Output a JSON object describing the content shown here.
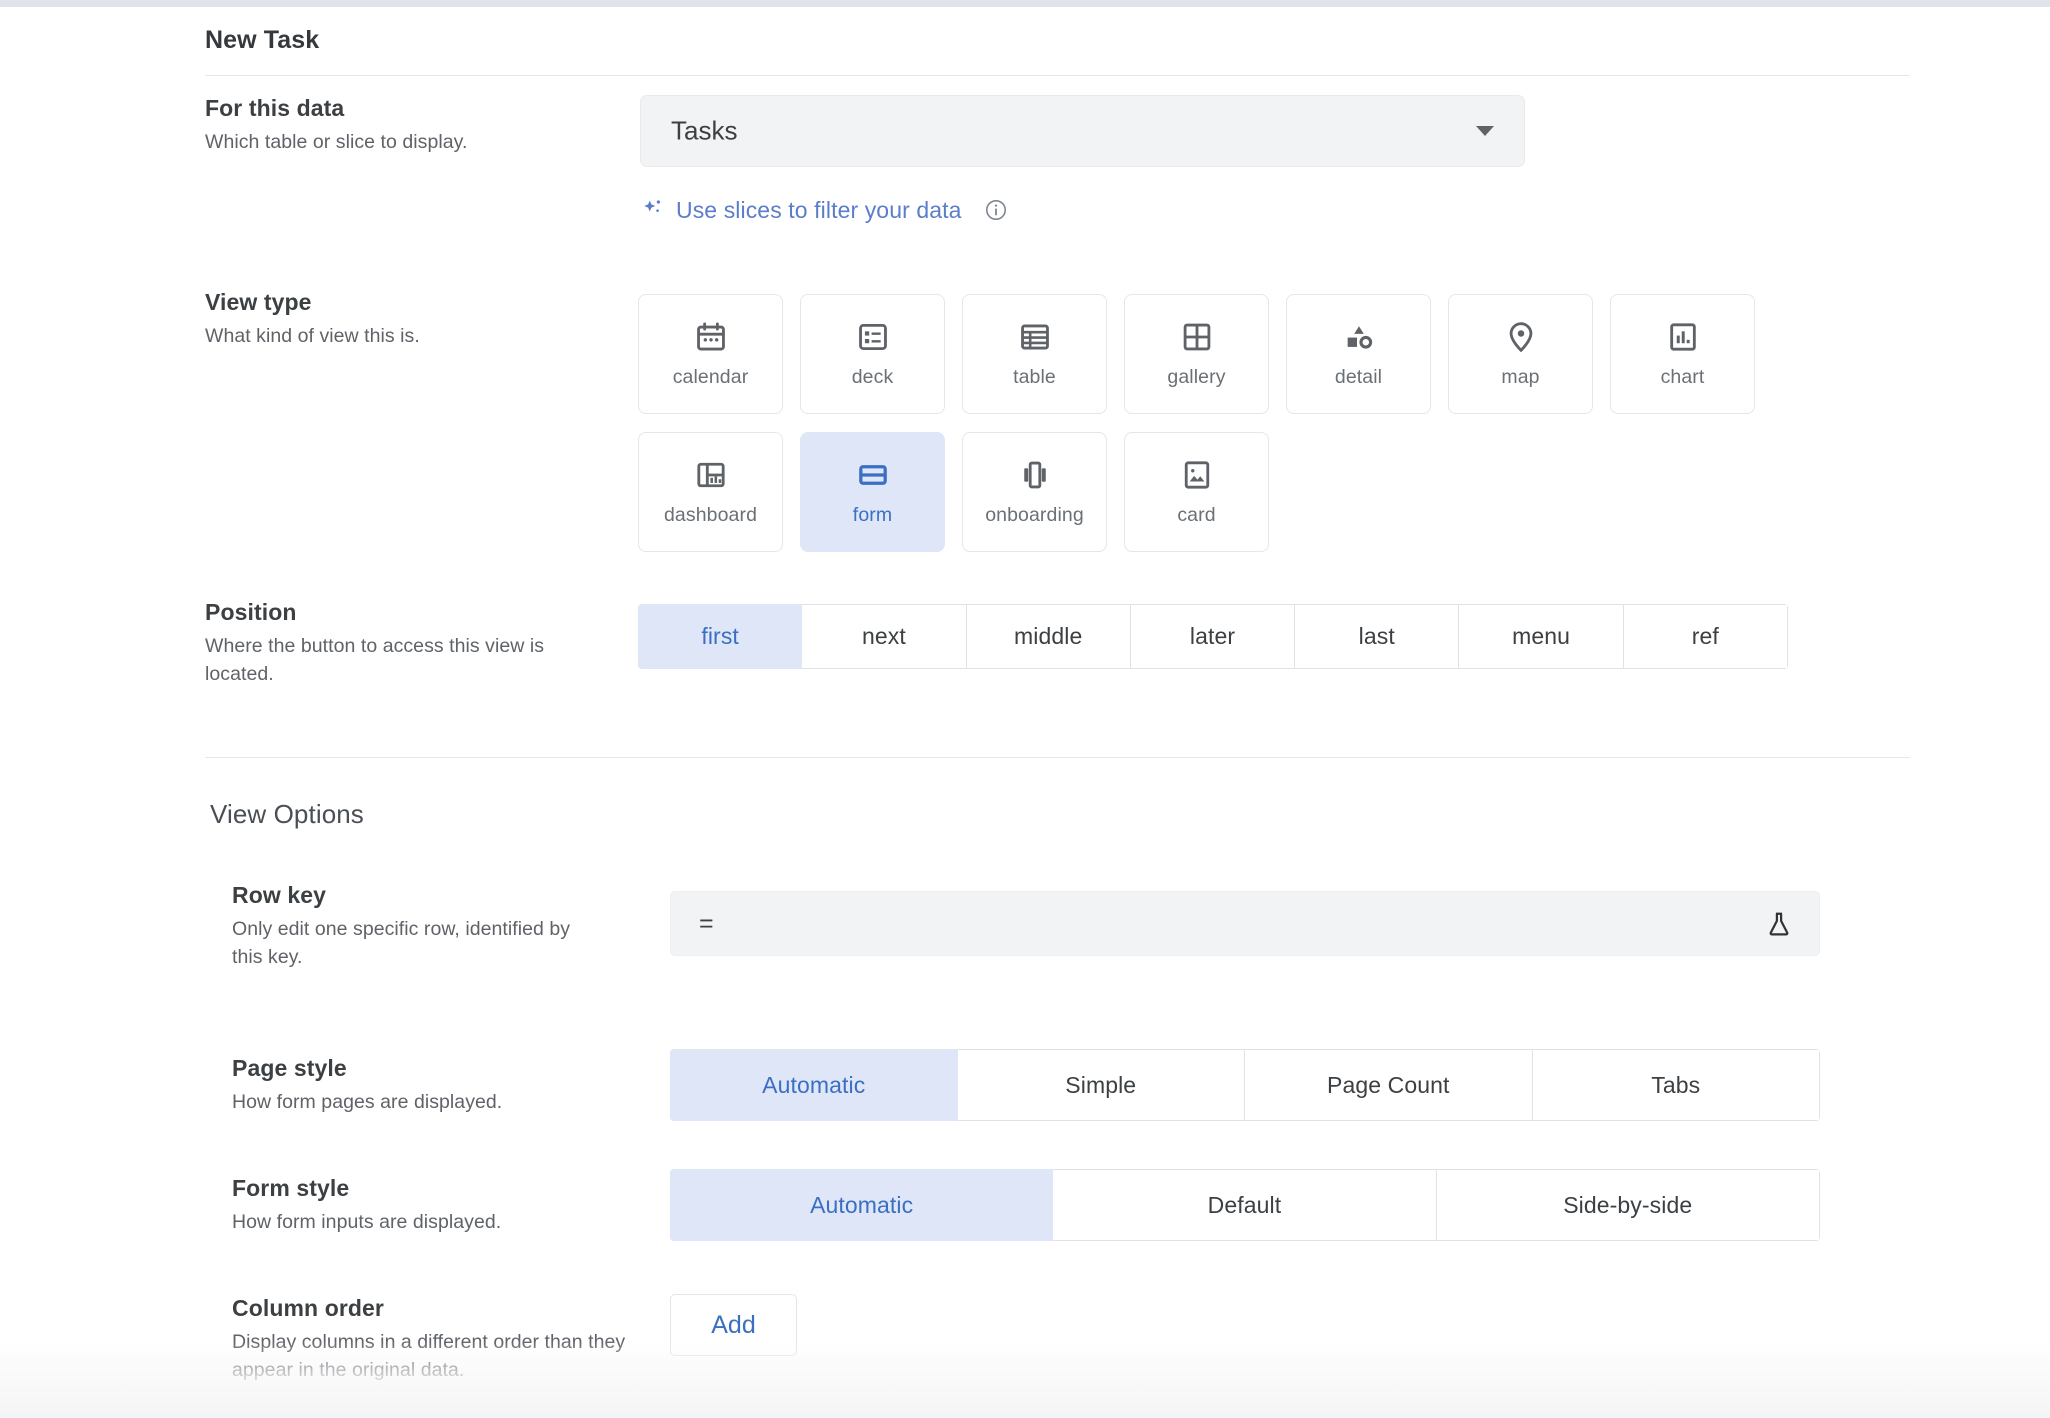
{
  "header": {
    "title": "New Task"
  },
  "for_this_data": {
    "label": "For this data",
    "description": "Which table or slice to display.",
    "selected": "Tasks",
    "slices_link": "Use slices to filter your data",
    "sparkle_icon": "sparkle-icon",
    "info_icon": "info-icon",
    "caret_icon": "chevron-down-icon"
  },
  "view_type": {
    "label": "View type",
    "description": "What kind of view this is.",
    "selected": "form",
    "row1": [
      {
        "name": "calendar",
        "icon": "calendar-icon"
      },
      {
        "name": "deck",
        "icon": "deck-icon"
      },
      {
        "name": "table",
        "icon": "table-icon"
      },
      {
        "name": "gallery",
        "icon": "gallery-icon"
      },
      {
        "name": "detail",
        "icon": "shapes-icon"
      },
      {
        "name": "map",
        "icon": "map-pin-icon"
      },
      {
        "name": "chart",
        "icon": "bar-chart-icon"
      }
    ],
    "row2": [
      {
        "name": "dashboard",
        "icon": "dashboard-icon"
      },
      {
        "name": "form",
        "icon": "form-icon"
      },
      {
        "name": "onboarding",
        "icon": "onboarding-icon"
      },
      {
        "name": "card",
        "icon": "image-card-icon"
      }
    ]
  },
  "position": {
    "label": "Position",
    "description": "Where the button to access this view is located.",
    "selected": "first",
    "options": [
      "first",
      "next",
      "middle",
      "later",
      "last",
      "menu",
      "ref"
    ]
  },
  "view_options": {
    "heading": "View Options",
    "row_key": {
      "label": "Row key",
      "description": "Only edit one specific row, identified by this key.",
      "value": "",
      "prefix": "=",
      "flask_icon": "flask-icon"
    },
    "page_style": {
      "label": "Page style",
      "description": "How form pages are displayed.",
      "selected": "Automatic",
      "options": [
        "Automatic",
        "Simple",
        "Page Count",
        "Tabs"
      ]
    },
    "form_style": {
      "label": "Form style",
      "description": "How form inputs are displayed.",
      "selected": "Automatic",
      "options": [
        "Automatic",
        "Default",
        "Side-by-side"
      ]
    },
    "column_order": {
      "label": "Column order",
      "description": "Display columns in a different order than they appear in the original data.",
      "add_label": "Add"
    }
  },
  "colors": {
    "accent": "#3b6fc4",
    "selected_bg": "#dee6f7",
    "field_bg": "#f1f3f4",
    "text": "#3c4043",
    "muted": "#5f6368"
  }
}
